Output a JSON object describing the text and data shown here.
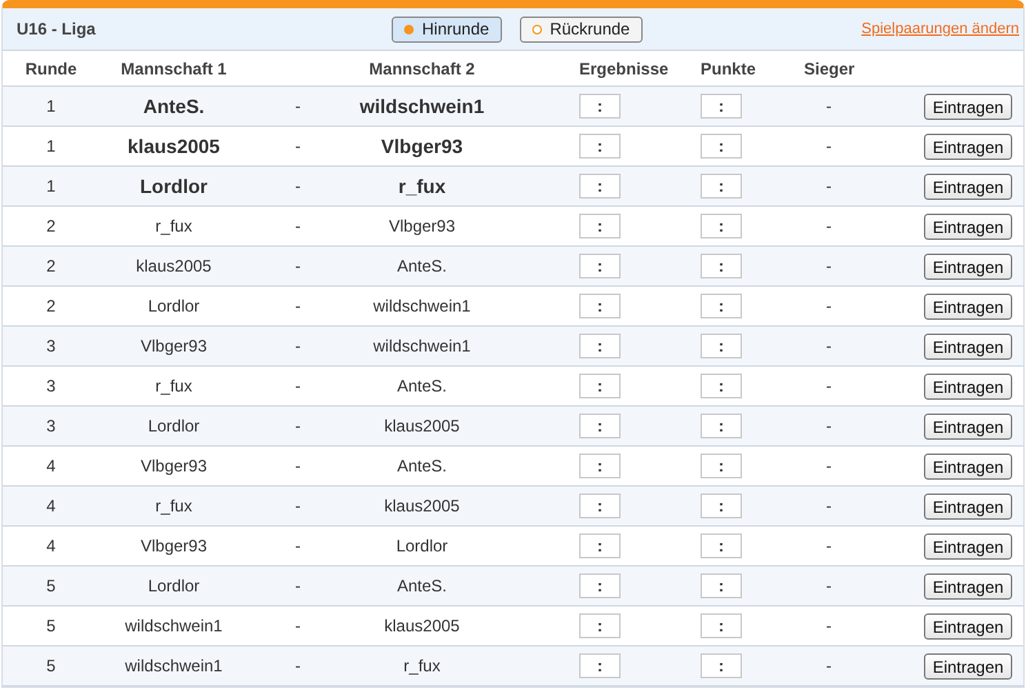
{
  "title": "U16 - Liga",
  "round_tabs": [
    {
      "label": "Hinrunde",
      "selected": true
    },
    {
      "label": "Rückrunde",
      "selected": false
    }
  ],
  "edit_link": "Spielpaarungen ändern",
  "columns": [
    "Runde",
    "Mannschaft 1",
    "Mannschaft 2",
    "Ergebnisse",
    "Punkte",
    "Sieger"
  ],
  "rows": [
    {
      "round": "1",
      "team1": "AnteS.",
      "separator": "-",
      "team2": "wildschwein1",
      "result": ":",
      "points": ":",
      "winner": "-",
      "button": "Eintragen",
      "bold": true
    },
    {
      "round": "1",
      "team1": "klaus2005",
      "separator": "-",
      "team2": "Vlbger93",
      "result": ":",
      "points": ":",
      "winner": "-",
      "button": "Eintragen",
      "bold": true
    },
    {
      "round": "1",
      "team1": "Lordlor",
      "separator": "-",
      "team2": "r_fux",
      "result": ":",
      "points": ":",
      "winner": "-",
      "button": "Eintragen",
      "bold": true
    },
    {
      "round": "2",
      "team1": "r_fux",
      "separator": "-",
      "team2": "Vlbger93",
      "result": ":",
      "points": ":",
      "winner": "-",
      "button": "Eintragen",
      "bold": false
    },
    {
      "round": "2",
      "team1": "klaus2005",
      "separator": "-",
      "team2": "AnteS.",
      "result": ":",
      "points": ":",
      "winner": "-",
      "button": "Eintragen",
      "bold": false
    },
    {
      "round": "2",
      "team1": "Lordlor",
      "separator": "-",
      "team2": "wildschwein1",
      "result": ":",
      "points": ":",
      "winner": "-",
      "button": "Eintragen",
      "bold": false
    },
    {
      "round": "3",
      "team1": "Vlbger93",
      "separator": "-",
      "team2": "wildschwein1",
      "result": ":",
      "points": ":",
      "winner": "-",
      "button": "Eintragen",
      "bold": false
    },
    {
      "round": "3",
      "team1": "r_fux",
      "separator": "-",
      "team2": "AnteS.",
      "result": ":",
      "points": ":",
      "winner": "-",
      "button": "Eintragen",
      "bold": false
    },
    {
      "round": "3",
      "team1": "Lordlor",
      "separator": "-",
      "team2": "klaus2005",
      "result": ":",
      "points": ":",
      "winner": "-",
      "button": "Eintragen",
      "bold": false
    },
    {
      "round": "4",
      "team1": "Vlbger93",
      "separator": "-",
      "team2": "AnteS.",
      "result": ":",
      "points": ":",
      "winner": "-",
      "button": "Eintragen",
      "bold": false
    },
    {
      "round": "4",
      "team1": "r_fux",
      "separator": "-",
      "team2": "klaus2005",
      "result": ":",
      "points": ":",
      "winner": "-",
      "button": "Eintragen",
      "bold": false
    },
    {
      "round": "4",
      "team1": "Vlbger93",
      "separator": "-",
      "team2": "Lordlor",
      "result": ":",
      "points": ":",
      "winner": "-",
      "button": "Eintragen",
      "bold": false
    },
    {
      "round": "5",
      "team1": "Lordlor",
      "separator": "-",
      "team2": "AnteS.",
      "result": ":",
      "points": ":",
      "winner": "-",
      "button": "Eintragen",
      "bold": false
    },
    {
      "round": "5",
      "team1": "wildschwein1",
      "separator": "-",
      "team2": "klaus2005",
      "result": ":",
      "points": ":",
      "winner": "-",
      "button": "Eintragen",
      "bold": false
    },
    {
      "round": "5",
      "team1": "wildschwein1",
      "separator": "-",
      "team2": "r_fux",
      "result": ":",
      "points": ":",
      "winner": "-",
      "button": "Eintragen",
      "bold": false
    }
  ]
}
